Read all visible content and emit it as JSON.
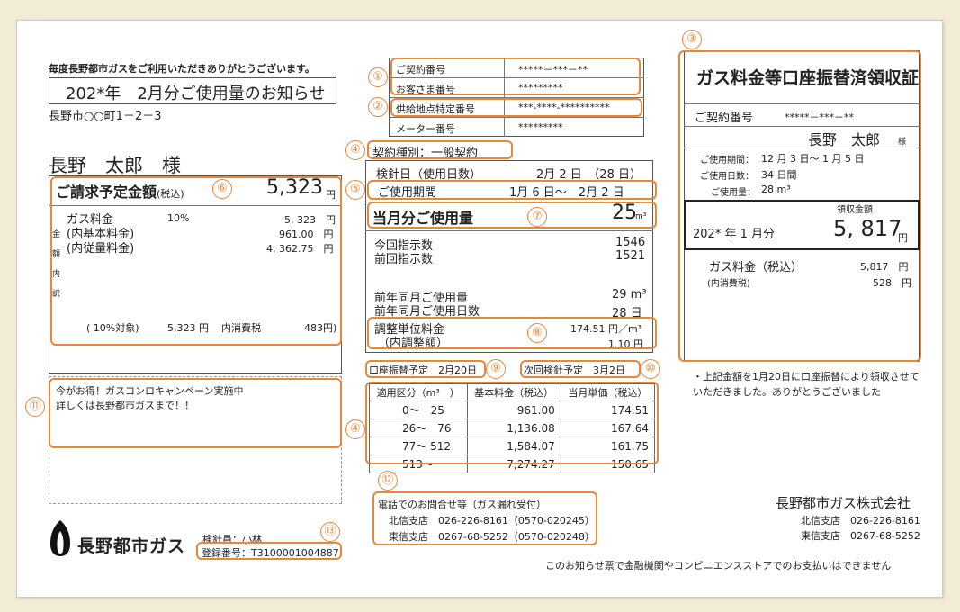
{
  "greeting": "毎度長野都市ガスをご利用いただきありがとうございます。",
  "notice_title": "202*年　2月分ご使用量のお知らせ",
  "address": "長野市○○町1－2－3",
  "customer_name": "長野　太郎　様",
  "contract_info": {
    "contract_no_label": "ご契約番号",
    "contract_no_value": "*****－***－**",
    "customer_no_label": "お客さま番号",
    "customer_no_value": "*********",
    "supply_point_label": "供給地点特定番号",
    "supply_point_value": "***-****-**********",
    "meter_no_label": "メーター番号",
    "meter_no_value": "*********"
  },
  "billing": {
    "title": "ご請求予定金額",
    "tax_note": "(税込)",
    "amount": "5,323",
    "yen": "円",
    "side_label": [
      "金",
      "額",
      "内",
      "訳"
    ],
    "gas_fee_label": "ガス料金",
    "gas_fee_rate": "10%",
    "gas_fee_value": "5, 323　円",
    "base_fee_label": "(内基本料金)",
    "base_fee_value": "961.00　円",
    "usage_fee_label": "(内従量料金)",
    "usage_fee_value": "4, 362.75　円",
    "tax_target_label": "( 10%対象)",
    "tax_target_value": "5,323 円",
    "consumption_tax_label": "内消費税",
    "consumption_tax_value": "483円)"
  },
  "campaign": {
    "line1": "今がお得！ガスコンロキャンペーン実施中",
    "line2": "詳しくは長野都市ガスまで！！"
  },
  "company_logo_text": "長野都市ガス",
  "meter_reader": "検針員：小林",
  "registration_no": "登録番号：T3100001004887",
  "usage": {
    "contract_type": "契約種別：一般契約",
    "reading_date_label": "検針日（使用日数）",
    "reading_date_value": "2月 2 日　（28 日）",
    "period_label": "ご使用期間",
    "period_value": "1月 6 日～　2月 2 日",
    "this_month_label": "当月分ご使用量",
    "this_month_value": "25",
    "unit_m3": "m³",
    "current_reading_label": "今回指示数",
    "current_reading_value": "1546",
    "previous_reading_label": "前回指示数",
    "previous_reading_value": "1521",
    "last_year_usage_label": "前年同月ご使用量",
    "last_year_usage_value": "29 m³",
    "last_year_days_label": "前年同月ご使用日数",
    "last_year_days_value": "28 日",
    "adjust_label": "調整単位料金",
    "adjust_value": "174.51 円／m³",
    "adjust_sub_label": "（内調整額）",
    "adjust_sub_value": "1.10 円"
  },
  "transfer_schedule": "口座振替予定　2月20日",
  "next_reading": "次回検針予定　3月2日",
  "rate_table": {
    "headers": [
      "適用区分（m³　）",
      "基本料金（税込）",
      "当月単価（税込）"
    ],
    "rows": [
      [
        "0～　25",
        "961.00",
        "174.51"
      ],
      [
        "26～　76",
        "1,136.08",
        "167.64"
      ],
      [
        "77～ 512",
        "1,584.07",
        "161.75"
      ],
      [
        "513～",
        "7,274.27",
        "150.65"
      ]
    ]
  },
  "contact": {
    "title": "電話でのお問合せ等（ガス漏れ受付）",
    "line1": "北信支店　026-226-8161（0570-020245）",
    "line2": "東信支店　0267-68-5252（0570-020248）"
  },
  "receipt": {
    "title": "ガス料金等口座振替済領収証",
    "contract_no_label": "ご契約番号",
    "contract_no_value": "*****－***－**",
    "name": "長野　太郎",
    "sama": "様",
    "period_label": "ご使用期間：",
    "period_value": "12 月 3 日～ 1 月 5 日",
    "days_label": "ご使用日数：",
    "days_value": "34 日間",
    "usage_label": "ご使用量：",
    "usage_value": "28 m³",
    "received_label": "領収金額",
    "month": "202* 年 1 月分",
    "amount": "5, 817",
    "yen": "円",
    "gas_fee_label": "ガス料金（税込）",
    "gas_fee_value": "5,817　円",
    "tax_label": "(内消費税)",
    "tax_value": "528　円",
    "note": "・上記金額を1月20日に口座振替により領収させていただきました。ありがとうございました"
  },
  "company": {
    "name": "長野都市ガス株式会社",
    "hokushin": "北信支店　026-226-8161",
    "toshin": "東信支店　0267-68-5252"
  },
  "footer_note": "このお知らせ票で金融機関やコンビニエンスストアでのお支払いはできません",
  "markers": [
    "①",
    "②",
    "③",
    "④",
    "⑤",
    "⑥",
    "⑦",
    "⑧",
    "⑨",
    "⑩",
    "⑪",
    "⑫",
    "⑬",
    "④"
  ],
  "colors": {
    "accent": "#e8863a",
    "background": "#f3ecd6"
  }
}
